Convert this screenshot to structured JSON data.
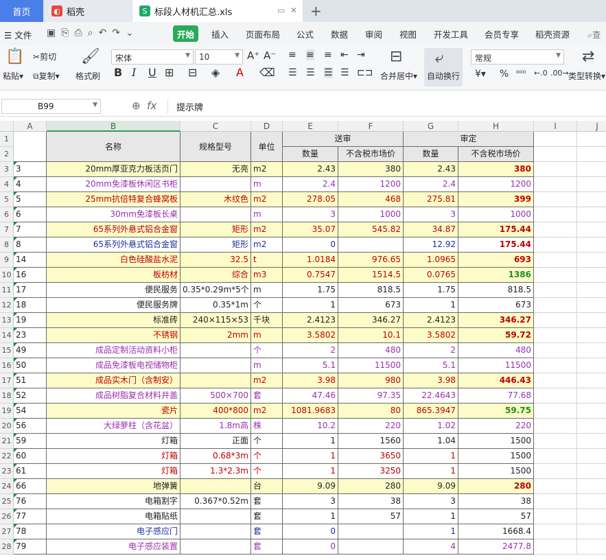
{
  "tabs": {
    "home": "首页",
    "daoke": "稻壳",
    "file": "标段人材机汇总.xls"
  },
  "menu": {
    "file": "文件",
    "items": [
      "开始",
      "插入",
      "页面布局",
      "公式",
      "数据",
      "审阅",
      "视图",
      "开发工具",
      "会员专享",
      "稻壳资源"
    ],
    "search": "查"
  },
  "ribbon": {
    "paste": "粘贴",
    "cut": "剪切",
    "copy": "复制",
    "format_painter": "格式刷",
    "font_name": "宋体",
    "font_size": "10",
    "merge": "合并居中",
    "wrap": "自动换行",
    "number_format": "常规",
    "convert": "类型转换"
  },
  "formula": {
    "cell_ref": "B99",
    "fx": "fx",
    "content": "提示牌"
  },
  "columns": [
    "A",
    "B",
    "C",
    "D",
    "E",
    "F",
    "G",
    "H",
    "I",
    "J"
  ],
  "header": {
    "name": "名称",
    "spec": "规格型号",
    "unit": "单位",
    "submit": "送审",
    "approve": "审定",
    "qty": "数量",
    "price": "不含税市场价"
  },
  "rows": [
    {
      "n": "3",
      "a": "3",
      "b": "20mm厚亚克力板活页门",
      "c": "无亮",
      "d": "m2",
      "e": "2.43",
      "f": "380",
      "g": "2.43",
      "h": "380",
      "bg": "y",
      "col": "#222",
      "hc": "#c00000",
      "hb": true
    },
    {
      "n": "4",
      "a": "4",
      "b": "20mm免漆板休闲区书柜",
      "c": "",
      "d": "m",
      "e": "2.4",
      "f": "1200",
      "g": "2.4",
      "h": "1200",
      "bg": "",
      "col": "#9b2fae",
      "hc": "#9b2fae",
      "hb": false
    },
    {
      "n": "5",
      "a": "5",
      "b": "25mm抗倍特复合蜂窝板",
      "c": "木纹色",
      "d": "m2",
      "e": "278.05",
      "f": "468",
      "g": "275.81",
      "h": "399",
      "bg": "y",
      "col": "#c00000",
      "hc": "#c00000",
      "hb": true
    },
    {
      "n": "6",
      "a": "6",
      "b": "30mm免漆板长桌",
      "c": "",
      "d": "m",
      "e": "3",
      "f": "1000",
      "g": "3",
      "h": "1000",
      "bg": "",
      "col": "#9b2fae",
      "hc": "#9b2fae",
      "hb": false
    },
    {
      "n": "7",
      "a": "7",
      "b": "65系列外悬式铝合金窗",
      "c": "矩形",
      "d": "m2",
      "e": "35.07",
      "f": "545.82",
      "g": "34.87",
      "h": "175.44",
      "bg": "y",
      "col": "#c00000",
      "hc": "#c00000",
      "hb": true
    },
    {
      "n": "8",
      "a": "8",
      "b": "65系列外悬式铝合金窗",
      "c": "矩形",
      "d": "m2",
      "e": "0",
      "f": "",
      "g": "12.92",
      "h": "175.44",
      "bg": "",
      "col": "#1f2f9c",
      "hc": "#c00000",
      "hb": true
    },
    {
      "n": "9",
      "a": "14",
      "b": "白色硅酸盐水泥",
      "c": "32.5",
      "d": "t",
      "e": "1.0184",
      "f": "976.65",
      "g": "1.0965",
      "h": "693",
      "bg": "y",
      "col": "#c00000",
      "hc": "#c00000",
      "hb": true
    },
    {
      "n": "10",
      "a": "16",
      "b": "板枋材",
      "c": "综合",
      "d": "m3",
      "e": "0.7547",
      "f": "1514.5",
      "g": "0.0765",
      "h": "1386",
      "bg": "y",
      "col": "#c00000",
      "hc": "#1e8f1e",
      "hb": true
    },
    {
      "n": "11",
      "a": "17",
      "b": "便民服务",
      "c": "0.35*0.29m*5个",
      "d": "m",
      "e": "1.75",
      "f": "818.5",
      "g": "1.75",
      "h": "818.5",
      "bg": "",
      "col": "#222",
      "hc": "#222",
      "hb": false
    },
    {
      "n": "12",
      "a": "18",
      "b": "便民服务牌",
      "c": "0.35*1m",
      "d": "个",
      "e": "1",
      "f": "673",
      "g": "1",
      "h": "673",
      "bg": "",
      "col": "#222",
      "hc": "#222",
      "hb": false
    },
    {
      "n": "13",
      "a": "19",
      "b": "标准砖",
      "c": "240×115×53",
      "d": "千块",
      "e": "2.4123",
      "f": "346.27",
      "g": "2.4123",
      "h": "346.27",
      "bg": "y",
      "col": "#222",
      "hc": "#c00000",
      "hb": true
    },
    {
      "n": "14",
      "a": "23",
      "b": "不锈钢",
      "c": "2mm",
      "d": "m",
      "e": "3.5802",
      "f": "10.1",
      "g": "3.5802",
      "h": "59.72",
      "bg": "y",
      "col": "#c00000",
      "hc": "#c00000",
      "hb": true
    },
    {
      "n": "15",
      "a": "49",
      "b": "成品定制活动资料小柜",
      "c": "",
      "d": "个",
      "e": "2",
      "f": "480",
      "g": "2",
      "h": "480",
      "bg": "",
      "col": "#9b2fae",
      "hc": "#9b2fae",
      "hb": false
    },
    {
      "n": "16",
      "a": "50",
      "b": "成品免漆板电视储物柜",
      "c": "",
      "d": "m",
      "e": "5.1",
      "f": "11500",
      "g": "5.1",
      "h": "11500",
      "bg": "",
      "col": "#9b2fae",
      "hc": "#9b2fae",
      "hb": false
    },
    {
      "n": "17",
      "a": "51",
      "b": "成品实木门（含制安）",
      "c": "",
      "d": "m2",
      "e": "3.98",
      "f": "980",
      "g": "3.98",
      "h": "446.43",
      "bg": "y",
      "col": "#c00000",
      "hc": "#c00000",
      "hb": true
    },
    {
      "n": "18",
      "a": "52",
      "b": "成品树脂复合材料井盖",
      "c": "500×700",
      "d": "套",
      "e": "47.46",
      "f": "97.35",
      "g": "22.4643",
      "h": "77.68",
      "bg": "",
      "col": "#9b2fae",
      "hc": "#9b2fae",
      "hb": false
    },
    {
      "n": "19",
      "a": "54",
      "b": "瓷片",
      "c": "400*800",
      "d": "m2",
      "e": "1081.9683",
      "f": "80",
      "g": "865.3947",
      "h": "59.75",
      "bg": "y",
      "col": "#c00000",
      "hc": "#1e8f1e",
      "hb": true
    },
    {
      "n": "20",
      "a": "56",
      "b": "大绿萝柱（含花盆）",
      "c": "1.8m高",
      "d": "株",
      "e": "10.2",
      "f": "220",
      "g": "1.02",
      "h": "220",
      "bg": "",
      "col": "#9b2fae",
      "hc": "#9b2fae",
      "hb": false
    },
    {
      "n": "21",
      "a": "59",
      "b": "灯箱",
      "c": "正面",
      "d": "个",
      "e": "1",
      "f": "1560",
      "g": "1.04",
      "h": "1500",
      "bg": "",
      "col": "#222",
      "hc": "#222",
      "hb": false
    },
    {
      "n": "22",
      "a": "60",
      "b": "灯箱",
      "c": "0.68*3m",
      "d": "个",
      "e": "1",
      "f": "3650",
      "g": "1",
      "h": "1500",
      "bg": "",
      "col": "#c00000",
      "hc": "#222",
      "hb": false
    },
    {
      "n": "23",
      "a": "61",
      "b": "灯箱",
      "c": "1.3*2.3m",
      "d": "个",
      "e": "1",
      "f": "3250",
      "g": "1",
      "h": "1500",
      "bg": "",
      "col": "#c00000",
      "hc": "#222",
      "hb": false
    },
    {
      "n": "24",
      "a": "66",
      "b": "地弹簧",
      "c": "",
      "d": "台",
      "e": "9.09",
      "f": "280",
      "g": "9.09",
      "h": "280",
      "bg": "y",
      "col": "#222",
      "hc": "#c00000",
      "hb": true
    },
    {
      "n": "25",
      "a": "76",
      "b": "电箱割字",
      "c": "0.367*0.52m",
      "d": "套",
      "e": "3",
      "f": "38",
      "g": "3",
      "h": "38",
      "bg": "",
      "col": "#222",
      "hc": "#222",
      "hb": false
    },
    {
      "n": "26",
      "a": "77",
      "b": "电箱贴纸",
      "c": "",
      "d": "套",
      "e": "1",
      "f": "57",
      "g": "1",
      "h": "57",
      "bg": "",
      "col": "#222",
      "hc": "#222",
      "hb": false
    },
    {
      "n": "27",
      "a": "78",
      "b": "电子感应门",
      "c": "",
      "d": "套",
      "e": "0",
      "f": "",
      "g": "1",
      "h": "1668.4",
      "bg": "",
      "col": "#1f2f9c",
      "hc": "#222",
      "hb": false
    },
    {
      "n": "28",
      "a": "79",
      "b": "电子感应装置",
      "c": "",
      "d": "套",
      "e": "0",
      "f": "",
      "g": "4",
      "h": "2477.8",
      "bg": "",
      "col": "#9b2fae",
      "hc": "#9b2fae",
      "hb": false
    }
  ]
}
